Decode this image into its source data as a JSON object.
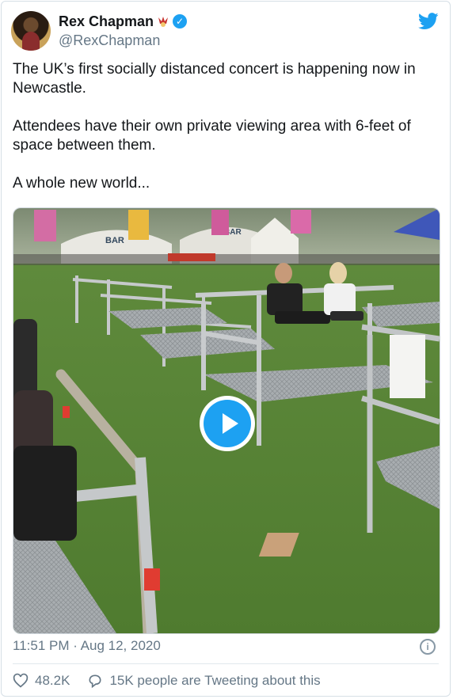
{
  "author": {
    "display_name": "Rex Chapman",
    "handle": "@RexChapman",
    "verified": true
  },
  "tweet": {
    "text": "The UK’s first socially distanced concert is happening now in Newcastle.\n\nAttendees have their own private viewing area with 6-feet of space between them.\n\nA whole new world..."
  },
  "media": {
    "type": "video",
    "signs": [
      "BAR",
      "BAR"
    ]
  },
  "meta": {
    "timestamp": "11:51 PM · Aug 12, 2020"
  },
  "actions": {
    "likes": "48.2K",
    "tweeting": "15K people are Tweeting about this"
  },
  "colors": {
    "accent": "#1da1f2",
    "secondary_text": "#657786"
  }
}
